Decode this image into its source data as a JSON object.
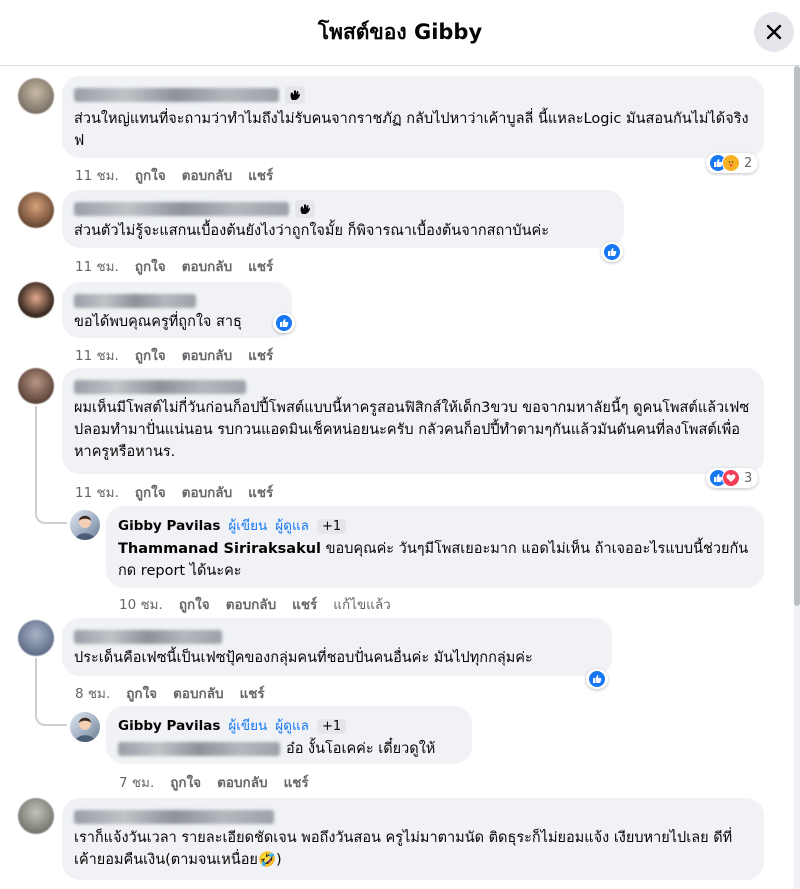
{
  "header": {
    "title": "โพสต์ของ Gibby"
  },
  "comments": [
    {
      "text": "ส่วนใหญ่แทนที่จะถามว่าทำไมถึงไม่รับคนจากราชภัฏ กลับไปหาว่าเค้าบูลลี่ นี้แหละLogic มันสอนกันไม่ได้จริงฟ",
      "time": "11 ชม.",
      "reaction_count": "2"
    },
    {
      "text": "ส่วนตัวไม่รู้จะแสกนเบื้องต้นยังไงว่าถูกใจมั้ย ก็พิจารณาเบื้องต้นจากสถาบันค่ะ",
      "time": "11 ชม."
    },
    {
      "text": "ขอได้พบคุณครูที่ถูกใจ สาธุ",
      "time": "11 ชม."
    },
    {
      "text": "ผมเห็นมีโพสต์ไม่กี่วันก่อนก็อปปี้โพสต์แบบนี้หาครูสอนฟิสิกส์ให้เด็ก3ขวบ ขอจากมหาลัยนี้ๆ ดูคนโพสต์แล้วเฟซปลอมทำมาปั่นแน่นอน รบกวนแอดมินเช็คหน่อยนะครับ กลัวคนก็อปปี้ทำตามๆกันแล้วมันดันคนที่ลงโพสต์เพื่อหาครูหรือหานร.",
      "time": "11 ชม.",
      "reaction_count": "3"
    },
    {
      "text": "ประเด็นคือเฟซนี้เป็นเฟซปุ้คของกลุ่มคนที่ชอบปั่นคนอื่นค่ะ มันไปทุกกลุ่มค่ะ",
      "time": "8 ชม."
    },
    {
      "text": "เราก็แจ้งวันเวลา รายละเอียดชัดเจน พอถึงวันสอน ครูไม่มาตามนัด ติดธุระก็ไม่ยอมแจ้ง เงียบหายไปเลย ดีที่เค้ายอมคืนเงิน(ตามจนเหนื่อย",
      "emoji": "🤣",
      "closing": ")"
    }
  ],
  "replies": [
    {
      "name": "Gibby Pavilas",
      "role_author": "ผู้เขียน",
      "role_admin": "ผู้ดูแล",
      "extra": "+1",
      "mention": "Thammanad Siriraksakul",
      "text": " ขอบคุณค่ะ วันๆมีโพสเยอะมาก แอดไม่เห็น ถ้าเจออะไรแบบนี้ช่วยกันกด report ได้นะคะ",
      "time": "10 ชม.",
      "edited": "แก้ไขแล้ว"
    },
    {
      "name": "Gibby Pavilas",
      "role_author": "ผู้เขียน",
      "role_admin": "ผู้ดูแล",
      "extra": "+1",
      "text": "อ๋อ งั้นโอเคค่ะ เดี๋ยวดูให้",
      "time": "7 ชม."
    }
  ],
  "actions": {
    "like": "ถูกใจ",
    "reply": "ตอบกลับ",
    "share": "แชร์"
  },
  "colors": {
    "accent": "#1877f2",
    "bubble": "#f0f2f5",
    "meta": "#65676b"
  },
  "icons": [
    "close-icon",
    "wave-hand-icon",
    "like-reaction-icon",
    "love-reaction-icon",
    "care-reaction-icon"
  ]
}
